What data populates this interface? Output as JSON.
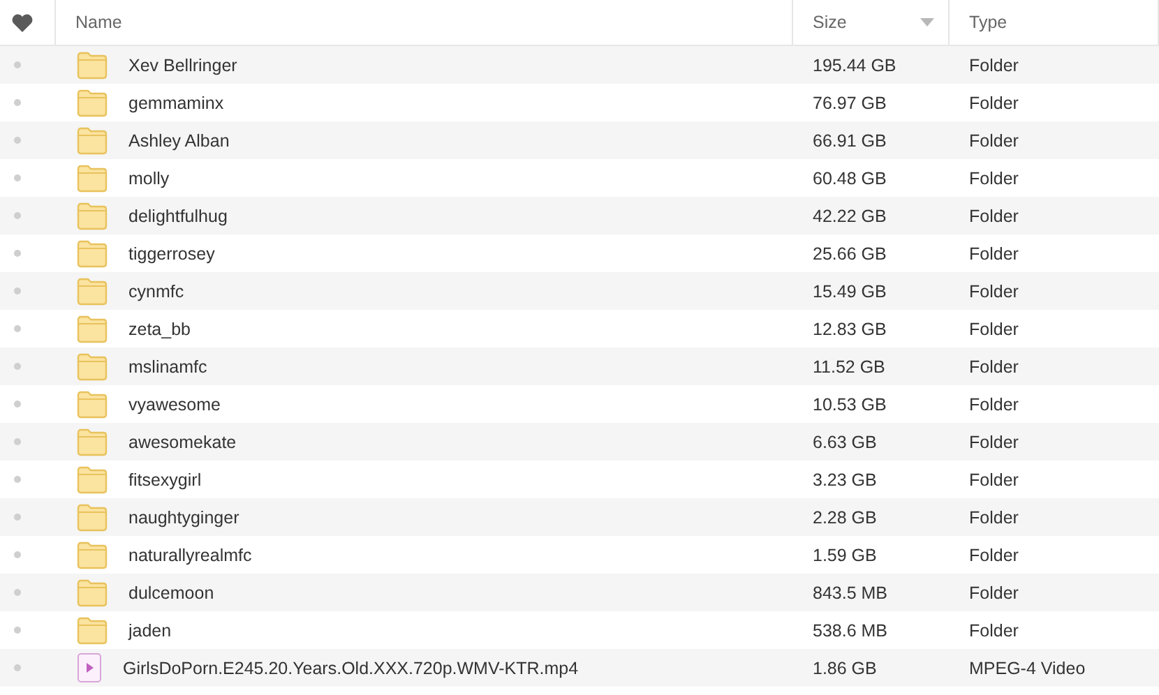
{
  "table": {
    "columns": [
      {
        "label": "Name",
        "sorted": false
      },
      {
        "label": "Size",
        "sorted": true
      },
      {
        "label": "Type",
        "sorted": false
      }
    ],
    "rows": [
      {
        "kind": "folder",
        "name": "Xev Bellringer",
        "size": "195.44 GB",
        "type": "Folder"
      },
      {
        "kind": "folder",
        "name": "gemmaminx",
        "size": "76.97 GB",
        "type": "Folder"
      },
      {
        "kind": "folder",
        "name": "Ashley Alban",
        "size": "66.91 GB",
        "type": "Folder"
      },
      {
        "kind": "folder",
        "name": "molly",
        "size": "60.48 GB",
        "type": "Folder"
      },
      {
        "kind": "folder",
        "name": "delightfulhug",
        "size": "42.22 GB",
        "type": "Folder"
      },
      {
        "kind": "folder",
        "name": "tiggerrosey",
        "size": "25.66 GB",
        "type": "Folder"
      },
      {
        "kind": "folder",
        "name": "cynmfc",
        "size": "15.49 GB",
        "type": "Folder"
      },
      {
        "kind": "folder",
        "name": "zeta_bb",
        "size": "12.83 GB",
        "type": "Folder"
      },
      {
        "kind": "folder",
        "name": "mslinamfc",
        "size": "11.52 GB",
        "type": "Folder"
      },
      {
        "kind": "folder",
        "name": "vyawesome",
        "size": "10.53 GB",
        "type": "Folder"
      },
      {
        "kind": "folder",
        "name": "awesomekate",
        "size": "6.63 GB",
        "type": "Folder"
      },
      {
        "kind": "folder",
        "name": "fitsexygirl",
        "size": "3.23 GB",
        "type": "Folder"
      },
      {
        "kind": "folder",
        "name": "naughtyginger",
        "size": "2.28 GB",
        "type": "Folder"
      },
      {
        "kind": "folder",
        "name": "naturallyrealmfc",
        "size": "1.59 GB",
        "type": "Folder"
      },
      {
        "kind": "folder",
        "name": "dulcemoon",
        "size": "843.5 MB",
        "type": "Folder"
      },
      {
        "kind": "folder",
        "name": "jaden",
        "size": "538.6 MB",
        "type": "Folder"
      },
      {
        "kind": "video",
        "name": "GirlsDoPorn.E245.20.Years.Old.XXX.720p.WMV-KTR.mp4",
        "size": "1.86 GB",
        "type": "MPEG-4 Video"
      }
    ]
  }
}
